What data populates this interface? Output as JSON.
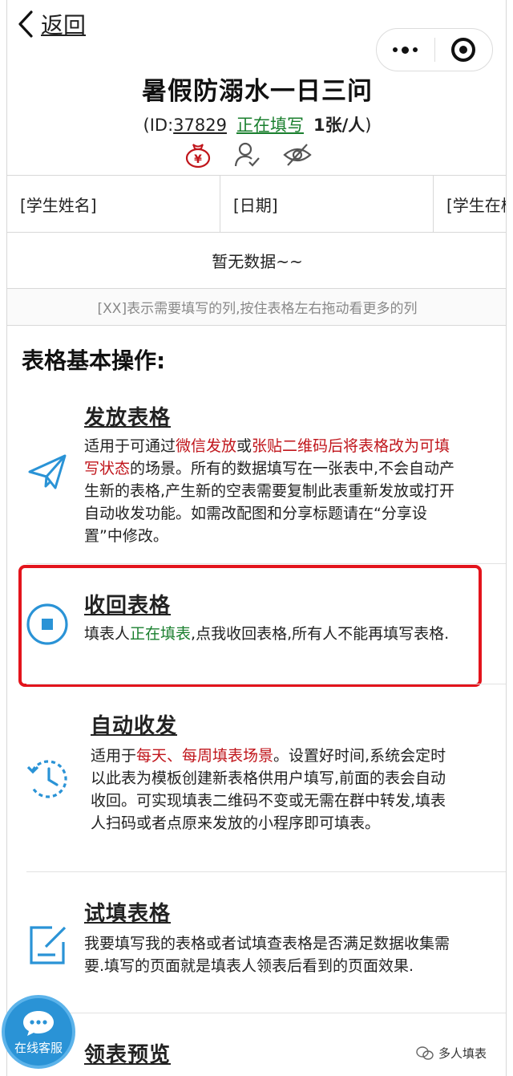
{
  "nav": {
    "back_label": "返回"
  },
  "form": {
    "title": "暑假防溺水一日三问",
    "id_prefix": "(ID:",
    "id_value": "37829",
    "status": "正在填写",
    "quota": "1张/人",
    "close_paren": ")"
  },
  "table": {
    "columns": [
      "[学生姓名]",
      "[日期]",
      "[学生在校"
    ],
    "empty_text": "暂无数据~~",
    "hint": "[XX]表示需要填写的列,按住表格左右拖动看更多的列"
  },
  "operations": {
    "section_title": "表格基本操作:",
    "items": [
      {
        "title": "发放表格",
        "desc_parts": [
          {
            "text": "适用于可通过",
            "style": "normal"
          },
          {
            "text": "微信发放",
            "style": "red"
          },
          {
            "text": "或",
            "style": "normal"
          },
          {
            "text": "张贴二维码后将表格改为可填写状态",
            "style": "red"
          },
          {
            "text": "的场景。所有的数据填写在一张表中,不会自动产生新的表格,产生新的空表需要复制此表重新发放或打开自动收发功能。如需改配图和分享标题请在“分享设置”中修改。",
            "style": "normal"
          }
        ]
      },
      {
        "title": "收回表格",
        "desc_parts": [
          {
            "text": "填表人",
            "style": "normal"
          },
          {
            "text": "正在填表",
            "style": "green"
          },
          {
            "text": ",点我收回表格,所有人不能再填写表格.",
            "style": "normal"
          }
        ]
      },
      {
        "title": "自动收发",
        "desc_parts": [
          {
            "text": "适用于",
            "style": "normal"
          },
          {
            "text": "每天、每周填表场景",
            "style": "red"
          },
          {
            "text": "。设置好时间,系统会定时以此表为模板创建新表格供用户填写,前面的表会自动收回。可实现填表二维码不变或无需在群中转发,填表人扫码或者点原来发放的小程序即可填表。",
            "style": "normal"
          }
        ]
      },
      {
        "title": "试填表格",
        "desc_parts": [
          {
            "text": "我要填写我的表格或者试填查表格是否满足数据收集需要.填写的页面就是填表人领表后看到的页面效果.",
            "style": "normal"
          }
        ]
      },
      {
        "title": "领表预览",
        "desc_parts": []
      }
    ]
  },
  "support": {
    "label": "在线客服"
  },
  "watermark": {
    "label": "多人填表"
  },
  "colors": {
    "accent_blue": "#2a93d6",
    "status_green": "#1a7f2e",
    "emphasis_red": "#c0151b",
    "highlight_red": "#e3141c"
  }
}
